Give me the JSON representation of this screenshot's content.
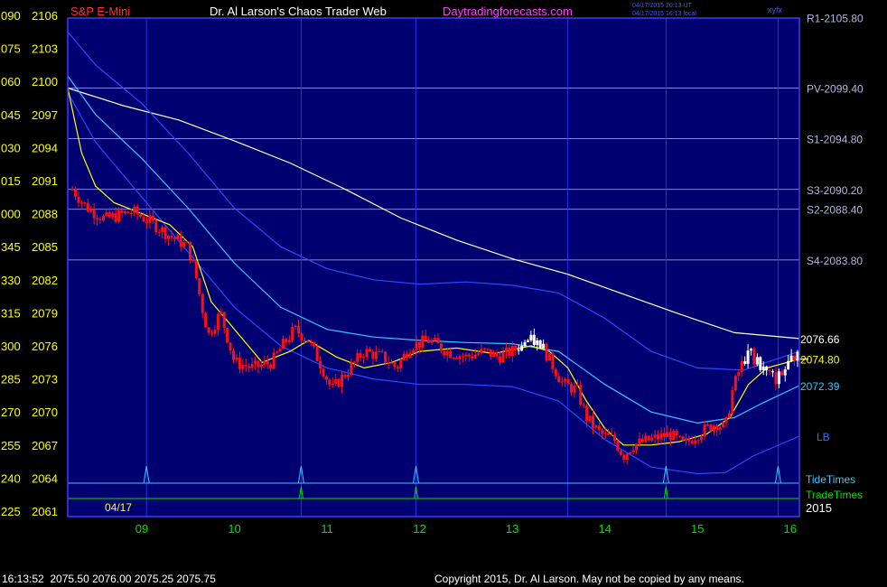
{
  "header": {
    "instrument": "S&P E-Mini",
    "title": "Dr. Al Larson's Chaos Trader Web",
    "site": "Daytradingforecasts.com",
    "timestamp_ut": "04/17/2015 20:13 UT",
    "timestamp_local": "04/17/2015 16:13 local",
    "top_right": "xyfx"
  },
  "date_label": "04/17",
  "year_label": "2015",
  "status_line": "16:13:52  2075.50 2076.00 2075.25 2075.75",
  "copyright": "Copyright 2015, Dr. Al Larson. May not be copied by any means.",
  "colors": {
    "background": "#000000",
    "plot_bg": "#000070",
    "frame": "#3c3cff",
    "up_candle": "#ffffff",
    "down_candle": "#ff1010",
    "yellow": "#ffff00",
    "cyan": "#37c8ff",
    "blue_band": "#2a4cff",
    "green": "#00e000",
    "level_line": "#b4b4dc",
    "red_text": "#ff3030",
    "magenta_text": "#ff40ff",
    "white_text": "#ffffff"
  },
  "chart_data": {
    "type": "candlestick",
    "x_ticks": [
      "09",
      "10",
      "11",
      "12",
      "13",
      "14",
      "15",
      "16"
    ],
    "y_ticks_price": [
      2106,
      2103,
      2100,
      2097,
      2094,
      2091,
      2088,
      2085,
      2082,
      2079,
      2076,
      2073,
      2070,
      2067,
      2064,
      2061
    ],
    "y_ticks_angle": [
      "090",
      "075",
      "060",
      "045",
      "030",
      "015",
      "000",
      "345",
      "330",
      "315",
      "300",
      "285",
      "270",
      "255",
      "240",
      "225"
    ],
    "ylim": [
      2061,
      2106
    ],
    "xlim": [
      8.2,
      16.1
    ],
    "levels": [
      {
        "label": "R1-2105.80",
        "value": 2105.8
      },
      {
        "label": "PV-2099.40",
        "value": 2099.4
      },
      {
        "label": "S1-2094.80",
        "value": 2094.8
      },
      {
        "label": "S3-2090.20",
        "value": 2090.2
      },
      {
        "label": "S2-2088.40",
        "value": 2088.4
      },
      {
        "label": "S4-2083.80",
        "value": 2083.8
      }
    ],
    "end_labels": [
      {
        "label": "2076.66",
        "value": 2076.66,
        "series": "ema_long"
      },
      {
        "label": "2074.80",
        "value": 2074.8,
        "series": "ema_short"
      },
      {
        "label": "2072.39",
        "value": 2072.39,
        "series": "cyan_band"
      },
      {
        "label": "LB",
        "value": 2067.8,
        "series": "lower_band"
      }
    ],
    "tide_times_label": "TideTimes",
    "trade_times_label": "TradeTimes",
    "tide_times": [
      9.05,
      10.72,
      11.96,
      14.66,
      15.87
    ],
    "trade_times": [
      10.72,
      11.96,
      14.66
    ],
    "vertical_time_lines": [
      9.05,
      10.72,
      11.96,
      13.6,
      14.66,
      15.87
    ],
    "price_path": [
      [
        8.25,
        2090.2
      ],
      [
        8.4,
        2088.6
      ],
      [
        8.6,
        2087.5
      ],
      [
        8.9,
        2088.2
      ],
      [
        9.1,
        2087.2
      ],
      [
        9.3,
        2086.0
      ],
      [
        9.5,
        2085.0
      ],
      [
        9.58,
        2082.5
      ],
      [
        9.65,
        2079.5
      ],
      [
        9.72,
        2077.0
      ],
      [
        9.85,
        2079.0
      ],
      [
        10.0,
        2074.5
      ],
      [
        10.2,
        2074.0
      ],
      [
        10.4,
        2074.5
      ],
      [
        10.5,
        2075.8
      ],
      [
        10.65,
        2077.5
      ],
      [
        10.8,
        2076.5
      ],
      [
        10.95,
        2074.0
      ],
      [
        11.05,
        2072.0
      ],
      [
        11.2,
        2073.5
      ],
      [
        11.4,
        2075.5
      ],
      [
        11.6,
        2075.0
      ],
      [
        11.75,
        2074.0
      ],
      [
        11.9,
        2076.0
      ],
      [
        12.1,
        2076.5
      ],
      [
        12.3,
        2075.5
      ],
      [
        12.5,
        2075.0
      ],
      [
        12.7,
        2075.5
      ],
      [
        12.85,
        2075.0
      ],
      [
        13.0,
        2075.5
      ],
      [
        13.15,
        2076.5
      ],
      [
        13.3,
        2076.3
      ],
      [
        13.45,
        2074.0
      ],
      [
        13.55,
        2072.5
      ],
      [
        13.7,
        2072.0
      ],
      [
        13.8,
        2069.5
      ],
      [
        13.95,
        2068.0
      ],
      [
        14.1,
        2067.5
      ],
      [
        14.2,
        2066.0
      ],
      [
        14.3,
        2067.0
      ],
      [
        14.5,
        2067.5
      ],
      [
        14.7,
        2068.0
      ],
      [
        14.85,
        2067.0
      ],
      [
        15.0,
        2068.0
      ],
      [
        15.2,
        2069.0
      ],
      [
        15.3,
        2068.5
      ],
      [
        15.38,
        2072.0
      ],
      [
        15.46,
        2074.0
      ],
      [
        15.55,
        2075.5
      ],
      [
        15.65,
        2074.5
      ],
      [
        15.75,
        2073.5
      ],
      [
        15.85,
        2073.0
      ],
      [
        15.95,
        2074.0
      ],
      [
        16.08,
        2075.5
      ]
    ],
    "series": [
      {
        "id": "ema_long",
        "color": "#ffffcc",
        "x": [
          8.2,
          8.8,
          9.4,
          10.0,
          10.6,
          11.2,
          11.8,
          12.4,
          13.0,
          13.6,
          14.2,
          14.8,
          15.4,
          16.1
        ],
        "y": [
          2099.4,
          2097.8,
          2096.5,
          2094.6,
          2092.6,
          2090.2,
          2087.6,
          2085.6,
          2083.9,
          2082.5,
          2080.7,
          2078.9,
          2077.2,
          2076.66
        ]
      },
      {
        "id": "upper_blue",
        "color": "#2a4cff",
        "x": [
          8.2,
          8.5,
          9.0,
          9.5,
          10.0,
          10.5,
          11.0,
          11.5,
          12.0,
          12.5,
          13.0,
          13.5,
          14.0,
          14.5,
          15.0,
          15.5,
          16.1
        ],
        "y": [
          2104.5,
          2101.5,
          2098.0,
          2093.5,
          2088.5,
          2085.0,
          2083.0,
          2082.0,
          2081.6,
          2081.8,
          2081.5,
          2080.8,
          2078.5,
          2075.5,
          2074.0,
          2073.8,
          2075.5
        ]
      },
      {
        "id": "cyan_band",
        "color": "#37c8ff",
        "x": [
          8.2,
          8.5,
          9.0,
          9.5,
          10.0,
          10.5,
          11.0,
          11.5,
          12.0,
          12.5,
          13.0,
          13.5,
          14.0,
          14.5,
          15.0,
          15.4,
          15.7,
          16.1
        ],
        "y": [
          2100.5,
          2097.0,
          2093.0,
          2088.5,
          2083.5,
          2079.5,
          2077.5,
          2076.8,
          2076.5,
          2076.3,
          2076.2,
          2075.5,
          2072.5,
          2070.0,
          2069.0,
          2069.5,
          2070.8,
          2072.39
        ]
      },
      {
        "id": "lower_band",
        "color": "#2a4cff",
        "x": [
          8.2,
          8.5,
          9.0,
          9.5,
          10.0,
          10.5,
          11.0,
          11.5,
          12.0,
          12.5,
          13.0,
          13.5,
          14.0,
          14.5,
          15.0,
          15.3,
          15.6,
          16.1
        ],
        "y": [
          2099.0,
          2094.5,
          2089.5,
          2084.5,
          2079.5,
          2076.0,
          2074.0,
          2073.0,
          2072.5,
          2072.5,
          2072.3,
          2071.0,
          2067.5,
          2065.0,
          2064.4,
          2064.5,
          2066.0,
          2067.8
        ]
      },
      {
        "id": "ema_short",
        "color": "#ffff00",
        "x": [
          8.2,
          8.35,
          8.5,
          8.7,
          9.0,
          9.3,
          9.55,
          9.75,
          10.0,
          10.3,
          10.6,
          10.8,
          11.1,
          11.4,
          11.7,
          12.0,
          12.4,
          12.8,
          13.2,
          13.4,
          13.6,
          13.8,
          14.0,
          14.2,
          14.5,
          14.8,
          15.1,
          15.35,
          15.55,
          15.75,
          16.1
        ],
        "y": [
          2099.4,
          2093.5,
          2090.5,
          2089.0,
          2088.0,
          2087.0,
          2085.0,
          2080.0,
          2077.5,
          2074.5,
          2075.5,
          2076.5,
          2075.0,
          2074.0,
          2074.5,
          2075.5,
          2075.8,
          2075.3,
          2076.0,
          2075.5,
          2074.0,
          2071.0,
          2068.5,
          2067.0,
          2067.0,
          2067.3,
          2068.0,
          2069.5,
          2072.5,
          2074.0,
          2074.8
        ]
      }
    ]
  }
}
